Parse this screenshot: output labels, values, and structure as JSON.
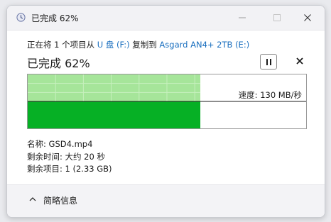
{
  "window": {
    "title": "已完成 62%",
    "minimize_icon": "minimize-icon",
    "maximize_icon": "maximize-icon",
    "close_icon": "close-icon"
  },
  "copy_status": {
    "prefix": "正在将 1 个项目从 ",
    "source": "U 盘 (F:)",
    "middle": " 复制到 ",
    "destination": "Asgard AN4+ 2TB (E:)",
    "percent_text": "已完成 62%",
    "percent_value": 0.62
  },
  "controls": {
    "pause_icon": "pause-icon",
    "cancel_icon": "close-icon"
  },
  "graph": {
    "speed_text": "速度: 130 MB/秒",
    "progress": 0.62,
    "colors": {
      "filled": "#06b025",
      "history": "#a6e59a",
      "grid": "#c7f0be",
      "speed_line": "#1b1b1b"
    }
  },
  "details": {
    "name": "名称: GSD4.mp4",
    "time_remaining": "剩余时间: 大约 20 秒",
    "items_remaining": "剩余项目: 1 (2.33 GB)"
  },
  "footer": {
    "chevron_icon": "chevron-up-icon",
    "less_details": "简略信息"
  }
}
